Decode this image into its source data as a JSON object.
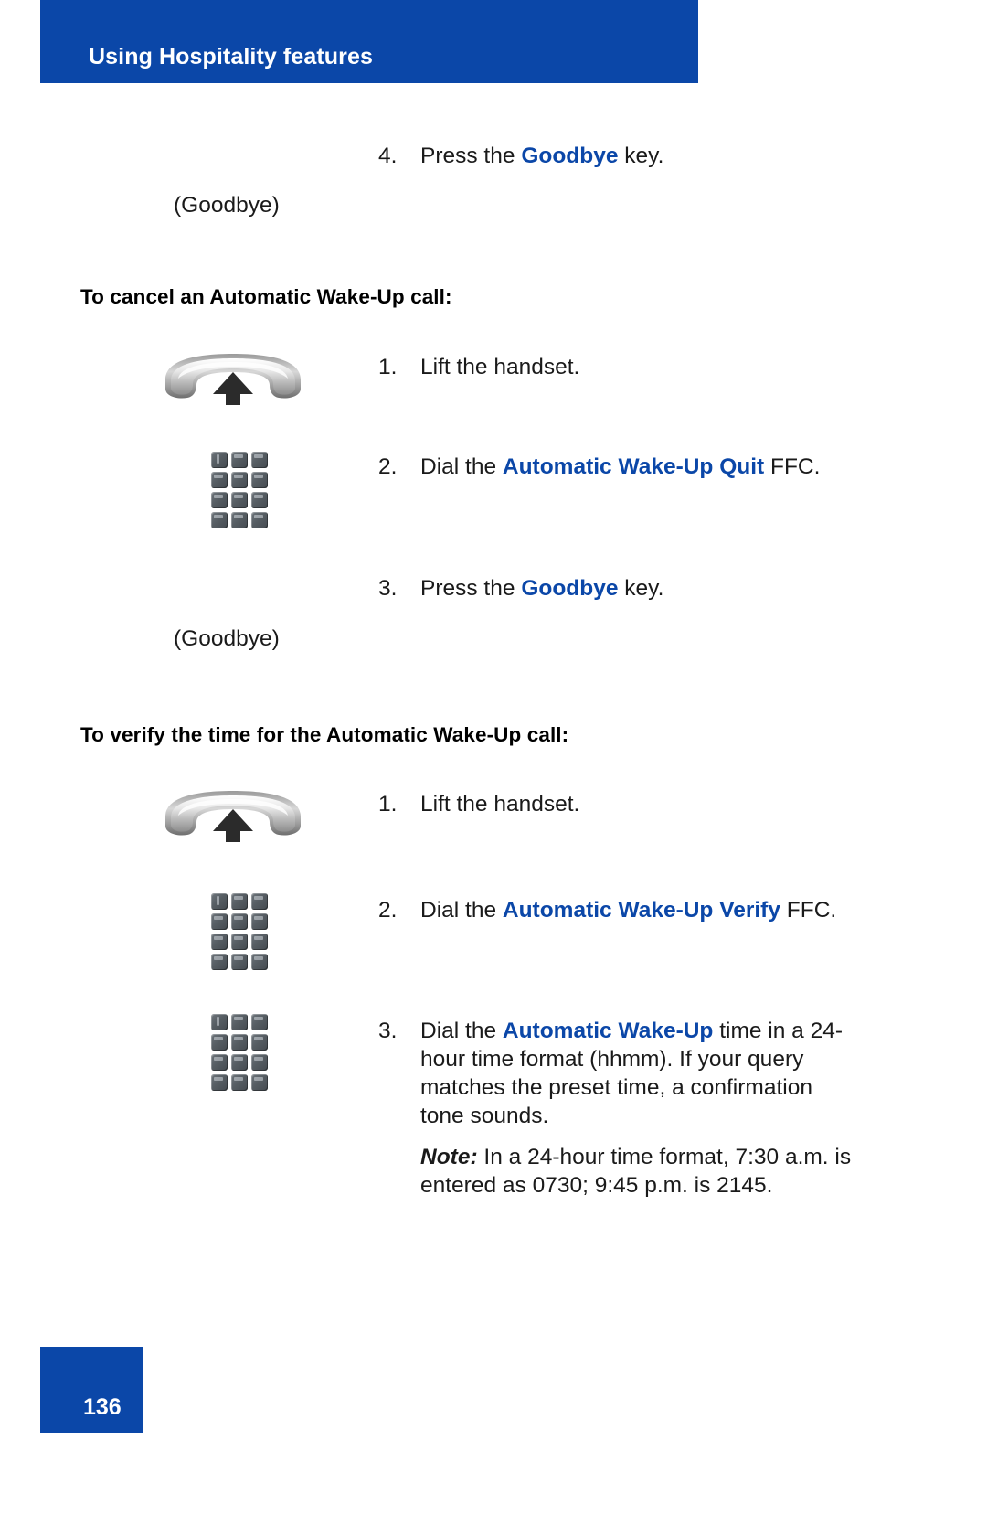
{
  "header": {
    "title": "Using Hospitality features"
  },
  "footer": {
    "page_number": "136"
  },
  "colors": {
    "banner_blue": "#0B47A8",
    "accent_blue": "#0B47A8",
    "text_black": "#1a1a1a",
    "key_gray": "#565d63"
  },
  "blocks": {
    "top_step": {
      "number": "4.",
      "text_before": "Press the ",
      "term": "Goodbye",
      "text_after": " key.",
      "left_label": "(Goodbye)"
    },
    "cancel_section": {
      "heading": "To cancel an Automatic Wake-Up call:",
      "steps": [
        {
          "number": "1.",
          "icon": "handset-icon",
          "text_before": "Lift the handset.",
          "term": "",
          "text_after": ""
        },
        {
          "number": "2.",
          "icon": "keypad-icon",
          "text_before": "Dial the ",
          "term": "Automatic Wake-Up Quit",
          "text_after": " FFC."
        },
        {
          "number": "3.",
          "icon": "",
          "text_before": "Press the ",
          "term": "Goodbye",
          "text_after": " key."
        }
      ],
      "left_label": "(Goodbye)"
    },
    "verify_section": {
      "heading": "To verify the time for the Automatic Wake-Up call:",
      "steps": [
        {
          "number": "1.",
          "icon": "handset-icon",
          "text_before": "Lift the handset.",
          "term": "",
          "text_after": ""
        },
        {
          "number": "2.",
          "icon": "keypad-icon",
          "text_before": "Dial the ",
          "term": "Automatic Wake-Up Verify",
          "text_after": " FFC."
        },
        {
          "number": "3.",
          "icon": "keypad-icon",
          "text_before": "Dial the ",
          "term": "Automatic Wake-Up",
          "text_after": " time in a 24-hour time format (hhmm). If your query matches the preset time, a confirmation tone sounds."
        }
      ],
      "note": {
        "label": "Note:",
        "text": " In a 24-hour time format, 7:30 a.m. is entered as 0730; 9:45 p.m. is 2145."
      }
    }
  }
}
